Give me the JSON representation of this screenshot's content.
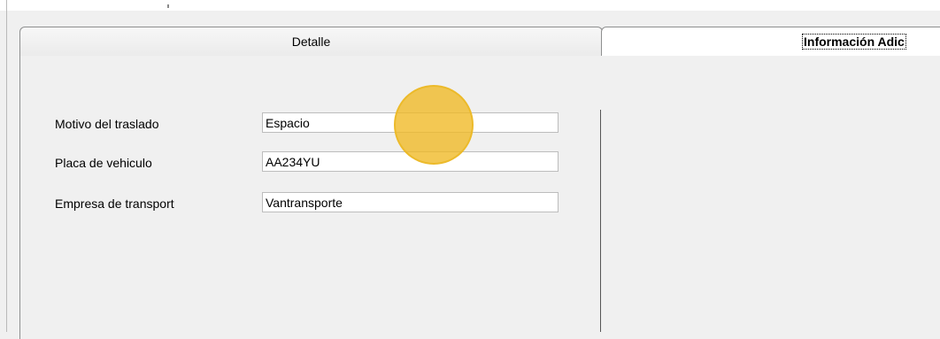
{
  "tabs": {
    "detalle_label": "Detalle",
    "info_label": "Información Adic"
  },
  "form": {
    "motivo_label": "Motivo del traslado",
    "motivo_value": "Espacio",
    "placa_label": "Placa de vehiculo",
    "placa_value": "AA234YU",
    "empresa_label": "Empresa de transport",
    "empresa_value": "Vantransporte"
  },
  "colors": {
    "background": "#f0f0f0",
    "cursor_highlight": "#f0b823"
  }
}
